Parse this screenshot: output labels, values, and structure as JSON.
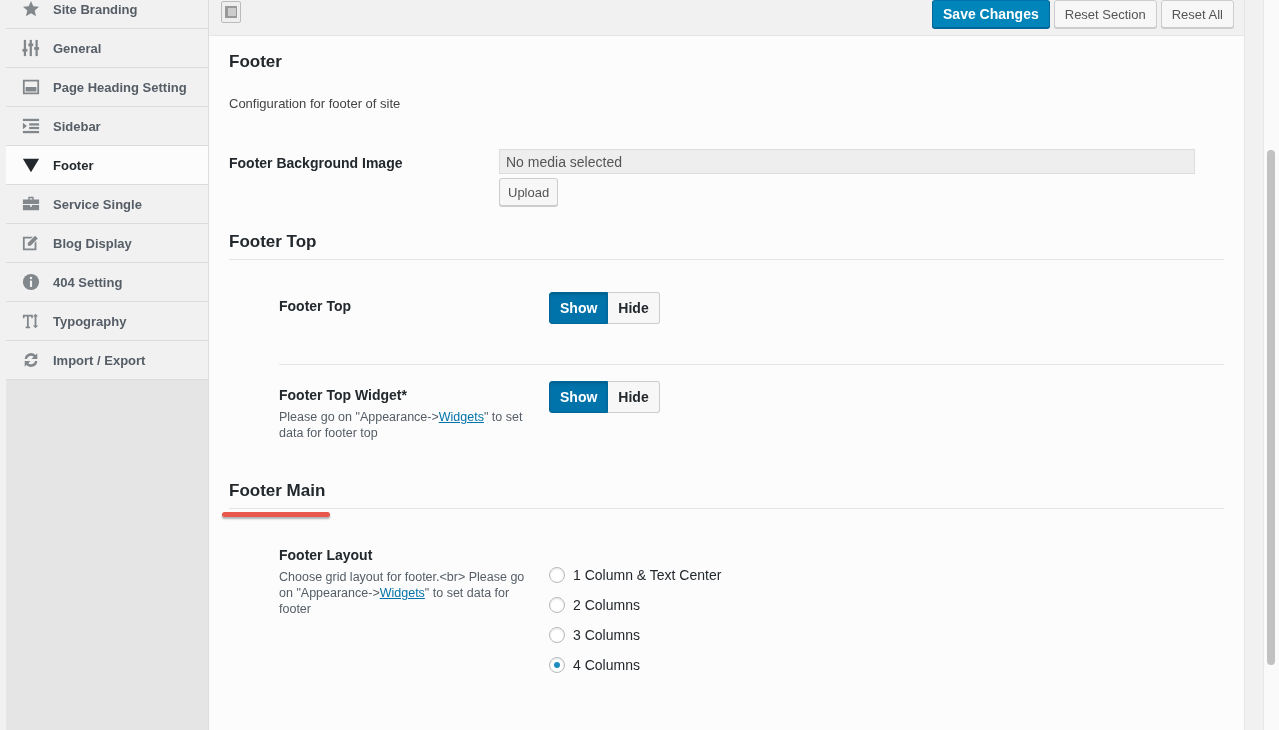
{
  "sidebar": {
    "items": [
      {
        "label": "Site Branding",
        "selected": false
      },
      {
        "label": "General",
        "selected": false
      },
      {
        "label": "Page Heading Setting",
        "selected": false
      },
      {
        "label": "Sidebar",
        "selected": false
      },
      {
        "label": "Footer",
        "selected": true
      },
      {
        "label": "Service Single",
        "selected": false
      },
      {
        "label": "Blog Display",
        "selected": false
      },
      {
        "label": "404 Setting",
        "selected": false
      },
      {
        "label": "Typography",
        "selected": false
      },
      {
        "label": "Import / Export",
        "selected": false
      }
    ]
  },
  "toolbar": {
    "buttons": [
      {
        "label": "Save Changes",
        "kind": "primary"
      },
      {
        "label": "Reset Section",
        "kind": "secondary"
      },
      {
        "label": "Reset All",
        "kind": "secondary"
      }
    ]
  },
  "sections": [
    {
      "kind": "intro",
      "title": "Footer",
      "description": "Configuration for footer of site",
      "fields": [
        {
          "kind": "media",
          "label": "Footer Background Image",
          "value": "No media selected",
          "button": "Upload"
        }
      ]
    },
    {
      "kind": "group",
      "title": "Footer Top",
      "fields": [
        {
          "kind": "toggle",
          "label": "Footer Top",
          "options": [
            {
              "label": "Show",
              "selected": true
            },
            {
              "label": "Hide",
              "selected": false
            }
          ]
        },
        {
          "kind": "toggle",
          "label": "Footer Top Widget*",
          "description": {
            "before": "Please go on \"Appearance->",
            "link": "Widgets",
            "after": "\" to set data for footer top"
          },
          "options": [
            {
              "label": "Show",
              "selected": true
            },
            {
              "label": "Hide",
              "selected": false
            }
          ]
        }
      ]
    },
    {
      "kind": "group",
      "title": "Footer Main",
      "highlighted": true,
      "fields": [
        {
          "kind": "radio",
          "label": "Footer Layout",
          "description": {
            "before": "Choose grid layout for footer.<br> Please go on \"Appearance->",
            "link": "Widgets",
            "after": "\" to set data for footer"
          },
          "options": [
            {
              "label": "1 Column & Text Center",
              "selected": false
            },
            {
              "label": "2 Columns",
              "selected": false
            },
            {
              "label": "3 Columns",
              "selected": false
            },
            {
              "label": "4 Columns",
              "selected": true
            }
          ]
        }
      ]
    }
  ]
}
